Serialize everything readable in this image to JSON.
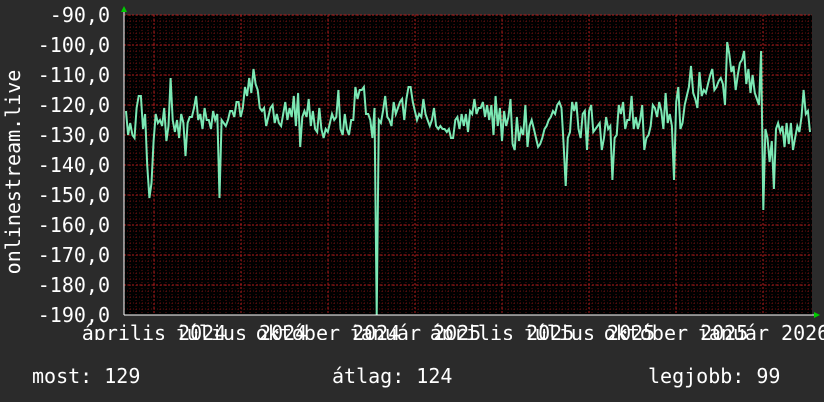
{
  "chart_data": {
    "type": "line",
    "ylabel": "onlinestream.live",
    "ylim": [
      -190,
      -90
    ],
    "y_ticks": [
      "-90,0",
      "-100,0",
      "-110,0",
      "-120,0",
      "-130,0",
      "-140,0",
      "-150,0",
      "-160,0",
      "-170,0",
      "-180,0",
      "-190,0"
    ],
    "x_ticks": [
      "április 2024",
      "július 2024",
      "október 2024",
      "január 2025",
      "április 2025",
      "július 2025",
      "október 2025",
      "január 2026"
    ],
    "grid": true,
    "colors": {
      "series": "#7ce8b4",
      "grid": "#b01c1c",
      "axis": "#ffffff",
      "background": "#000000",
      "arrow": "#00cc00"
    },
    "series": [
      {
        "values": [
          -122,
          -130,
          -126,
          -130,
          -131,
          -121,
          -117,
          -117,
          -128,
          -123,
          -140,
          -151,
          -146,
          -132,
          -123,
          -126,
          -125,
          -127,
          -121,
          -132,
          -127,
          -111,
          -125,
          -129,
          -125,
          -131,
          -123,
          -126,
          -137,
          -126,
          -124,
          -124,
          -121,
          -117,
          -125,
          -123,
          -128,
          -121,
          -125,
          -125,
          -128,
          -122,
          -125,
          -123,
          -151,
          -125,
          -126,
          -127,
          -125,
          -122,
          -122,
          -124,
          -119,
          -119,
          -124,
          -121,
          -114,
          -117,
          -111,
          -116,
          -108,
          -113,
          -115,
          -121,
          -122,
          -121,
          -127,
          -124,
          -121,
          -120,
          -126,
          -123,
          -126,
          -127,
          -123,
          -119,
          -125,
          -121,
          -124,
          -117,
          -127,
          -116,
          -134,
          -124,
          -122,
          -124,
          -118,
          -127,
          -122,
          -128,
          -129,
          -121,
          -128,
          -131,
          -128,
          -129,
          -126,
          -123,
          -125,
          -124,
          -115,
          -128,
          -130,
          -123,
          -128,
          -130,
          -125,
          -125,
          -114,
          -118,
          -115,
          -115,
          -114,
          -123,
          -123,
          -125,
          -131,
          -121,
          -190,
          -125,
          -126,
          -122,
          -117,
          -124,
          -125,
          -127,
          -119,
          -123,
          -121,
          -119,
          -118,
          -125,
          -118,
          -114,
          -114,
          -119,
          -122,
          -125,
          -123,
          -124,
          -118,
          -123,
          -125,
          -127,
          -125,
          -121,
          -127,
          -128,
          -127,
          -128,
          -128,
          -129,
          -128,
          -131,
          -131,
          -125,
          -124,
          -128,
          -123,
          -127,
          -123,
          -129,
          -122,
          -123,
          -118,
          -123,
          -121,
          -121,
          -119,
          -124,
          -120,
          -125,
          -120,
          -130,
          -117,
          -127,
          -121,
          -132,
          -122,
          -127,
          -124,
          -118,
          -133,
          -135,
          -124,
          -132,
          -128,
          -130,
          -120,
          -134,
          -127,
          -125,
          -128,
          -131,
          -134,
          -133,
          -131,
          -128,
          -127,
          -125,
          -124,
          -122,
          -123,
          -120,
          -119,
          -121,
          -133,
          -147,
          -131,
          -129,
          -119,
          -122,
          -119,
          -128,
          -131,
          -123,
          -122,
          -135,
          -122,
          -120,
          -129,
          -128,
          -127,
          -126,
          -135,
          -131,
          -124,
          -128,
          -127,
          -145,
          -131,
          -130,
          -120,
          -123,
          -119,
          -128,
          -125,
          -125,
          -117,
          -128,
          -124,
          -128,
          -125,
          -120,
          -135,
          -131,
          -130,
          -127,
          -120,
          -121,
          -124,
          -119,
          -122,
          -128,
          -116,
          -126,
          -123,
          -127,
          -145,
          -119,
          -114,
          -128,
          -126,
          -120,
          -117,
          -114,
          -107,
          -116,
          -118,
          -121,
          -109,
          -117,
          -115,
          -116,
          -113,
          -110,
          -108,
          -115,
          -114,
          -112,
          -111,
          -113,
          -120,
          -99,
          -103,
          -109,
          -107,
          -115,
          -110,
          -106,
          -105,
          -102,
          -113,
          -108,
          -116,
          -110,
          -116,
          -118,
          -120,
          -102,
          -155,
          -128,
          -131,
          -139,
          -132,
          -148,
          -128,
          -126,
          -129,
          -127,
          -134,
          -126,
          -133,
          -126,
          -135,
          -131,
          -127,
          -129,
          -124,
          -115,
          -123,
          -122,
          -129
        ]
      }
    ]
  },
  "stats": {
    "now": "most: 129",
    "avg": "átlag: 124",
    "best": "legjobb: 99"
  }
}
